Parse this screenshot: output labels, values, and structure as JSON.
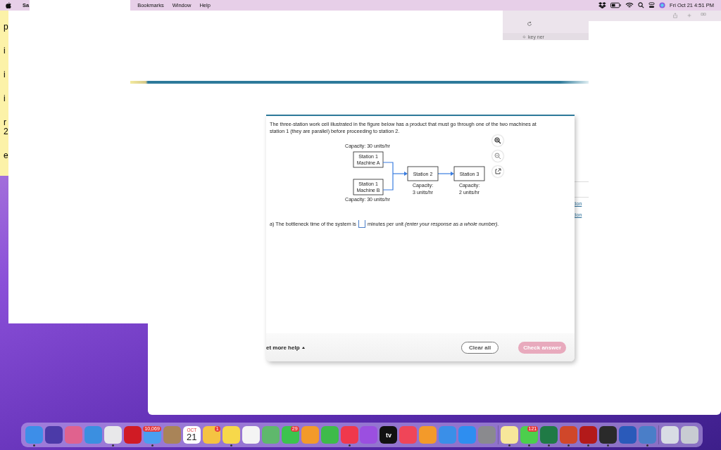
{
  "menu_bar": {
    "app_name": "Sa",
    "items": [
      "Bookmarks",
      "Window",
      "Help"
    ],
    "clock": "Fri Oct 21  4:51 PM"
  },
  "side_fragments": [
    "p",
    "i",
    "i",
    "i",
    "r",
    "2",
    "e"
  ],
  "browser": {
    "tab_fragment": "key ner"
  },
  "question": {
    "text": "The three-station work cell illustrated in the figure below has a product that must go through one of the two machines at station 1 (they are parallel) before proceeding to station 2.",
    "diagram": {
      "parallel_machines": [
        {
          "title": "Station 1",
          "machine": "Machine A",
          "capacity": "Capacity: 30 units/hr"
        },
        {
          "title": "Station 1",
          "machine": "Machine B",
          "capacity": "Capacity: 30 units/hr"
        }
      ],
      "serial_stations": [
        {
          "title": "Station 2",
          "capacity_label": "Capacity:",
          "capacity": "3 units/hr"
        },
        {
          "title": "Station 3",
          "capacity_label": "Capacity:",
          "capacity": "2 units/hr"
        }
      ]
    },
    "prompt_before": "a) The bottleneck time of the system is",
    "prompt_after": "minutes per unit *(enter your response as a whole number).*"
  },
  "footer": {
    "help": "et more help",
    "clear": "Clear all",
    "check": {
      "label": "Check answer",
      "disabled": true
    }
  },
  "side_links": [
    "tion",
    "tion"
  ],
  "dock": [
    {
      "kind": "app",
      "color": "#3d8ee8",
      "running": true
    },
    {
      "kind": "app",
      "color": "#4b3aa8",
      "running": false
    },
    {
      "kind": "app",
      "color": "#e0628e",
      "running": false
    },
    {
      "kind": "app",
      "color": "#3b8fe0",
      "running": false
    },
    {
      "kind": "app",
      "color": "#e8e8ea",
      "running": true
    },
    {
      "kind": "app",
      "color": "#d01b24",
      "running": false
    },
    {
      "kind": "app",
      "color": "#4a9ff0",
      "running": true,
      "badge": "10,069"
    },
    {
      "kind": "app",
      "color": "#a98458",
      "running": false
    },
    {
      "kind": "calendar",
      "color": "#ffffff",
      "running": false,
      "month": "OCT",
      "day": "21"
    },
    {
      "kind": "app",
      "color": "#f5c342",
      "running": false,
      "badge": "1"
    },
    {
      "kind": "app",
      "color": "#f7d84a",
      "running": true
    },
    {
      "kind": "app",
      "color": "#f4f4f4",
      "running": false
    },
    {
      "kind": "app",
      "color": "#5fb86c",
      "running": false
    },
    {
      "kind": "app",
      "color": "#3cc34e",
      "running": false,
      "badge": "29"
    },
    {
      "kind": "app",
      "color": "#f39a2a",
      "running": false
    },
    {
      "kind": "app",
      "color": "#3ebb4a",
      "running": false
    },
    {
      "kind": "app",
      "color": "#f0384c",
      "running": true
    },
    {
      "kind": "app",
      "color": "#9b4fe0",
      "running": false
    },
    {
      "kind": "tv",
      "color": "#111111",
      "running": false,
      "label": "tv"
    },
    {
      "kind": "app",
      "color": "#f04558",
      "running": false
    },
    {
      "kind": "app",
      "color": "#f39a2a",
      "running": false
    },
    {
      "kind": "app",
      "color": "#3a8fe8",
      "running": false
    },
    {
      "kind": "app",
      "color": "#2e8ef0",
      "running": false
    },
    {
      "kind": "app",
      "color": "#8a8a8e",
      "running": false
    },
    {
      "kind": "separator"
    },
    {
      "kind": "app",
      "color": "#f7e79a",
      "running": true
    },
    {
      "kind": "app",
      "color": "#4ccf4c",
      "running": true,
      "badge": "121"
    },
    {
      "kind": "app",
      "color": "#1f7a45",
      "running": true
    },
    {
      "kind": "app",
      "color": "#d0472a",
      "running": true
    },
    {
      "kind": "app",
      "color": "#b31a1a",
      "running": true
    },
    {
      "kind": "app",
      "color": "#2a2a2a",
      "running": true
    },
    {
      "kind": "app",
      "color": "#2a5aba",
      "running": false
    },
    {
      "kind": "app",
      "color": "#4a7ec8",
      "running": true
    },
    {
      "kind": "separator"
    },
    {
      "kind": "app",
      "color": "#d8dce4",
      "running": false
    },
    {
      "kind": "app",
      "color": "#c8ccd2",
      "running": false
    }
  ]
}
